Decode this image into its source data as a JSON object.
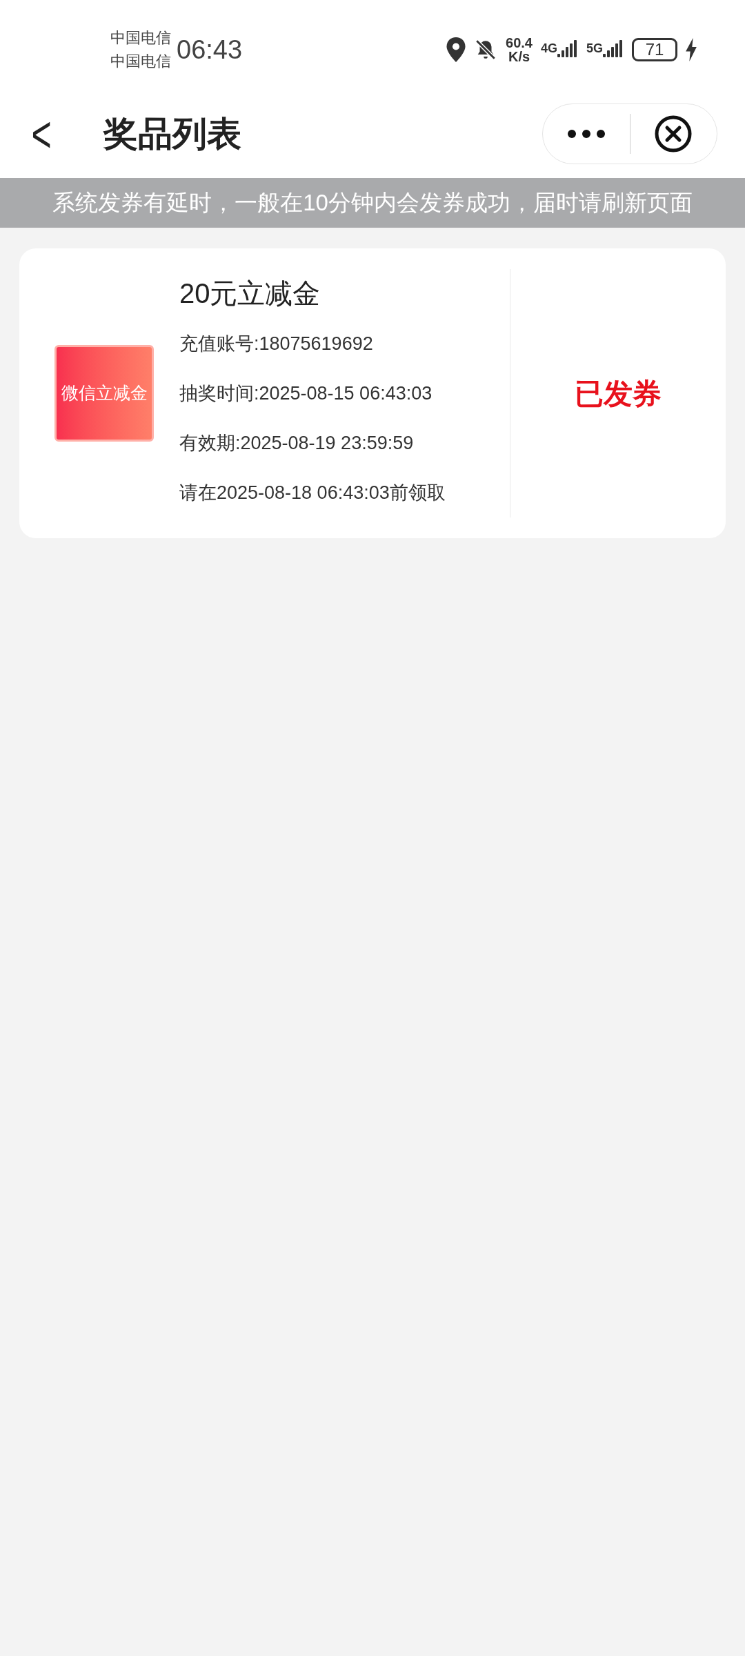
{
  "status_bar": {
    "carriers": [
      "中国电信",
      "中国电信"
    ],
    "time": "06:43",
    "speed": "60.4",
    "speed_unit": "K/s",
    "network_1": "4G",
    "network_2": "5G",
    "battery": "71"
  },
  "header": {
    "title": "奖品列表",
    "back": "<"
  },
  "notice": "系统发券有延时，一般在10分钟内会发券成功，届时请刷新页面",
  "prizes": [
    {
      "thumbnail": "微信立减金",
      "title": "20元立减金",
      "details": [
        "充值账号:18075619692",
        "抽奖时间:2025-08-15 06:43:03",
        "有效期:2025-08-19 23:59:59",
        "请在2025-08-18 06:43:03前领取"
      ],
      "status": "已发券"
    }
  ]
}
